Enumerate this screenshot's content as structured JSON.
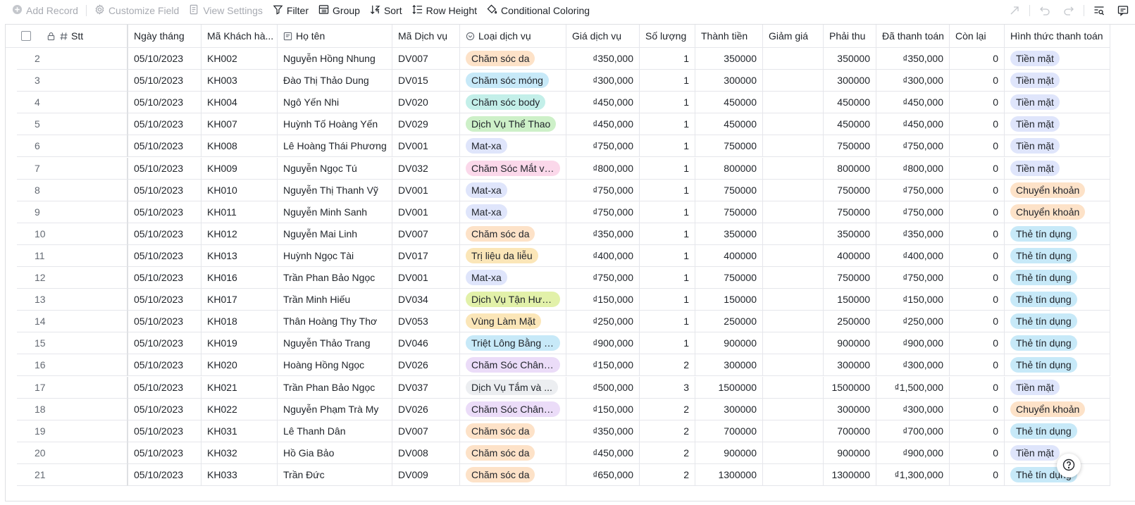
{
  "toolbar": {
    "add_record": "Add Record",
    "customize_field": "Customize Field",
    "view_settings": "View Settings",
    "filter": "Filter",
    "group": "Group",
    "sort": "Sort",
    "row_height": "Row Height",
    "conditional_coloring": "Conditional Coloring"
  },
  "columns": [
    "Stt",
    "Ngày tháng",
    "Mã Khách hà...",
    "Họ tên",
    "Mã Dịch vụ",
    "Loại dịch vụ",
    "Giá dịch vụ",
    "Số lượng",
    "Thành tiền",
    "Giảm giá",
    "Phải thu",
    "Đã thanh toán",
    "Còn lại",
    "Hình thức thanh toán"
  ],
  "tag_colors": {
    "Chăm sóc da": "#fde2c8",
    "Chăm sóc móng": "#c7e9f8",
    "Chăm sóc body": "#c3efe9",
    "Dịch Vụ Thể Thao": "#cdf0c8",
    "Mat-xa": "#dfe5fb",
    "Chăm Sóc Mắt và...": "#fbd8ea",
    "Trị liệu da liễu": "#fbe6b8",
    "Dịch Vụ Tận Hưở...": "#e2f1a9",
    "Vùng Làm Mặt": "#fbe6b8",
    "Triệt Lông Bằng L...": "#c7e9f8",
    "Chăm Sóc Chân v...": "#ebdcf8",
    "Dịch Vụ Tắm và ...": "#eceef1",
    "Tiền mặt": "#dfe5fb",
    "Chuyển khoản": "#fde2c8",
    "Thẻ tín dụng": "#c7e9f8"
  },
  "rows": [
    {
      "stt": "2",
      "date": "05/10/2023",
      "kh": "KH002",
      "name": "Nguyễn Hồng Nhung",
      "dv": "DV007",
      "type": "Chăm sóc da",
      "price": "₫350,000",
      "qty": "1",
      "total": "350000",
      "discount": "",
      "due": "350000",
      "paid": "₫350,000",
      "remain": "0",
      "method": "Tiền mặt"
    },
    {
      "stt": "3",
      "date": "05/10/2023",
      "kh": "KH003",
      "name": "Đào Thị Thảo Dung",
      "dv": "DV015",
      "type": "Chăm sóc móng",
      "price": "₫300,000",
      "qty": "1",
      "total": "300000",
      "discount": "",
      "due": "300000",
      "paid": "₫300,000",
      "remain": "0",
      "method": "Tiền mặt"
    },
    {
      "stt": "4",
      "date": "05/10/2023",
      "kh": "KH004",
      "name": "Ngô Yến Nhi",
      "dv": "DV020",
      "type": "Chăm sóc body",
      "price": "₫450,000",
      "qty": "1",
      "total": "450000",
      "discount": "",
      "due": "450000",
      "paid": "₫450,000",
      "remain": "0",
      "method": "Tiền mặt"
    },
    {
      "stt": "5",
      "date": "05/10/2023",
      "kh": "KH007",
      "name": "Huỳnh Tố Hoàng Yến",
      "dv": "DV029",
      "type": "Dịch Vụ Thể Thao",
      "price": "₫450,000",
      "qty": "1",
      "total": "450000",
      "discount": "",
      "due": "450000",
      "paid": "₫450,000",
      "remain": "0",
      "method": "Tiền mặt"
    },
    {
      "stt": "6",
      "date": "05/10/2023",
      "kh": "KH008",
      "name": "Lê Hoàng Thái Phương",
      "dv": "DV001",
      "type": "Mat-xa",
      "price": "₫750,000",
      "qty": "1",
      "total": "750000",
      "discount": "",
      "due": "750000",
      "paid": "₫750,000",
      "remain": "0",
      "method": "Tiền mặt"
    },
    {
      "stt": "7",
      "date": "05/10/2023",
      "kh": "KH009",
      "name": "Nguyễn Ngọc Tú",
      "dv": "DV032",
      "type": "Chăm Sóc Mắt và...",
      "price": "₫800,000",
      "qty": "1",
      "total": "800000",
      "discount": "",
      "due": "800000",
      "paid": "₫800,000",
      "remain": "0",
      "method": "Tiền mặt"
    },
    {
      "stt": "8",
      "date": "05/10/2023",
      "kh": "KH010",
      "name": "Nguyễn Thị Thanh Vỹ",
      "dv": "DV001",
      "type": "Mat-xa",
      "price": "₫750,000",
      "qty": "1",
      "total": "750000",
      "discount": "",
      "due": "750000",
      "paid": "₫750,000",
      "remain": "0",
      "method": "Chuyển khoản"
    },
    {
      "stt": "9",
      "date": "05/10/2023",
      "kh": "KH011",
      "name": "Nguyễn Minh Sanh",
      "dv": "DV001",
      "type": "Mat-xa",
      "price": "₫750,000",
      "qty": "1",
      "total": "750000",
      "discount": "",
      "due": "750000",
      "paid": "₫750,000",
      "remain": "0",
      "method": "Chuyển khoản"
    },
    {
      "stt": "10",
      "date": "05/10/2023",
      "kh": "KH012",
      "name": "Nguyễn Mai Linh",
      "dv": "DV007",
      "type": "Chăm sóc da",
      "price": "₫350,000",
      "qty": "1",
      "total": "350000",
      "discount": "",
      "due": "350000",
      "paid": "₫350,000",
      "remain": "0",
      "method": "Thẻ tín dụng"
    },
    {
      "stt": "11",
      "date": "05/10/2023",
      "kh": "KH013",
      "name": "Huỳnh Ngọc Tài",
      "dv": "DV017",
      "type": "Trị liệu da liễu",
      "price": "₫400,000",
      "qty": "1",
      "total": "400000",
      "discount": "",
      "due": "400000",
      "paid": "₫400,000",
      "remain": "0",
      "method": "Thẻ tín dụng"
    },
    {
      "stt": "12",
      "date": "05/10/2023",
      "kh": "KH016",
      "name": "Trần Phan Bảo Ngọc",
      "dv": "DV001",
      "type": "Mat-xa",
      "price": "₫750,000",
      "qty": "1",
      "total": "750000",
      "discount": "",
      "due": "750000",
      "paid": "₫750,000",
      "remain": "0",
      "method": "Thẻ tín dụng"
    },
    {
      "stt": "13",
      "date": "05/10/2023",
      "kh": "KH017",
      "name": "Trần Minh Hiếu",
      "dv": "DV034",
      "type": "Dịch Vụ Tận Hưở...",
      "price": "₫150,000",
      "qty": "1",
      "total": "150000",
      "discount": "",
      "due": "150000",
      "paid": "₫150,000",
      "remain": "0",
      "method": "Thẻ tín dụng"
    },
    {
      "stt": "14",
      "date": "05/10/2023",
      "kh": "KH018",
      "name": "Thân Hoàng Thy Thơ",
      "dv": "DV053",
      "type": "Vùng Làm Mặt",
      "price": "₫250,000",
      "qty": "1",
      "total": "250000",
      "discount": "",
      "due": "250000",
      "paid": "₫250,000",
      "remain": "0",
      "method": "Thẻ tín dụng"
    },
    {
      "stt": "15",
      "date": "05/10/2023",
      "kh": "KH019",
      "name": "Nguyễn Thảo Trang",
      "dv": "DV046",
      "type": "Triệt Lông Bằng L...",
      "price": "₫900,000",
      "qty": "1",
      "total": "900000",
      "discount": "",
      "due": "900000",
      "paid": "₫900,000",
      "remain": "0",
      "method": "Thẻ tín dụng"
    },
    {
      "stt": "16",
      "date": "05/10/2023",
      "kh": "KH020",
      "name": "Hoàng Hồng Ngọc",
      "dv": "DV026",
      "type": "Chăm Sóc Chân v...",
      "price": "₫150,000",
      "qty": "2",
      "total": "300000",
      "discount": "",
      "due": "300000",
      "paid": "₫300,000",
      "remain": "0",
      "method": "Thẻ tín dụng"
    },
    {
      "stt": "17",
      "date": "05/10/2023",
      "kh": "KH021",
      "name": "Trần Phan Bảo Ngọc",
      "dv": "DV037",
      "type": "Dịch Vụ Tắm và ...",
      "price": "₫500,000",
      "qty": "3",
      "total": "1500000",
      "discount": "",
      "due": "1500000",
      "paid": "₫1,500,000",
      "remain": "0",
      "method": "Tiền mặt"
    },
    {
      "stt": "18",
      "date": "05/10/2023",
      "kh": "KH022",
      "name": "Nguyễn Phạm Trà My",
      "dv": "DV026",
      "type": "Chăm Sóc Chân v...",
      "price": "₫150,000",
      "qty": "2",
      "total": "300000",
      "discount": "",
      "due": "300000",
      "paid": "₫300,000",
      "remain": "0",
      "method": "Chuyển khoản"
    },
    {
      "stt": "19",
      "date": "05/10/2023",
      "kh": "KH031",
      "name": "Lê Thanh Dân",
      "dv": "DV007",
      "type": "Chăm sóc da",
      "price": "₫350,000",
      "qty": "2",
      "total": "700000",
      "discount": "",
      "due": "700000",
      "paid": "₫700,000",
      "remain": "0",
      "method": "Thẻ tín dụng"
    },
    {
      "stt": "20",
      "date": "05/10/2023",
      "kh": "KH032",
      "name": "Hồ Gia Bảo",
      "dv": "DV008",
      "type": "Chăm sóc da",
      "price": "₫450,000",
      "qty": "2",
      "total": "900000",
      "discount": "",
      "due": "900000",
      "paid": "₫900,000",
      "remain": "0",
      "method": "Tiền mặt"
    },
    {
      "stt": "21",
      "date": "05/10/2023",
      "kh": "KH033",
      "name": "Trần Đức",
      "dv": "DV009",
      "type": "Chăm sóc da",
      "price": "₫650,000",
      "qty": "2",
      "total": "1300000",
      "discount": "",
      "due": "1300000",
      "paid": "₫1,300,000",
      "remain": "0",
      "method": "Thẻ tín dụng"
    }
  ]
}
